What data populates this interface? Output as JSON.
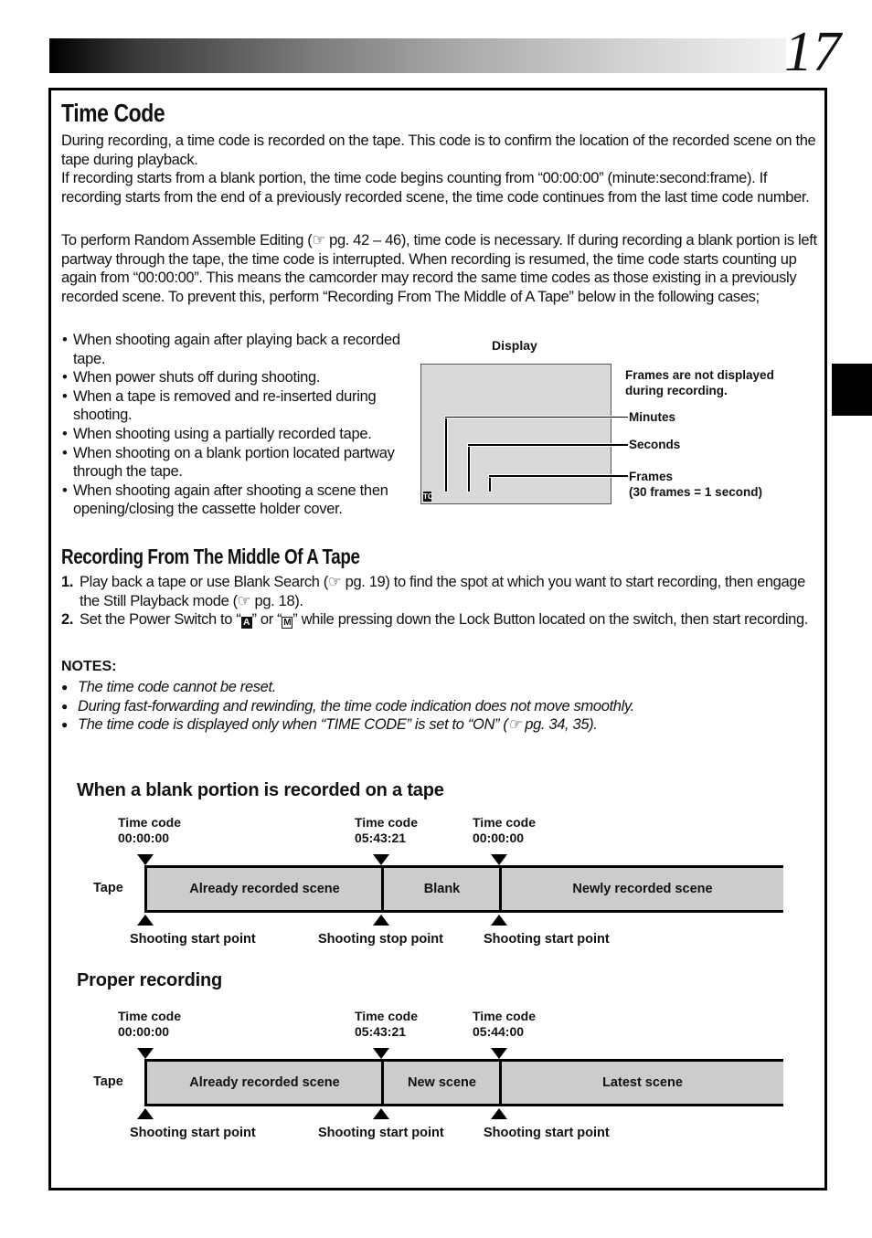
{
  "header": {
    "page_number": "17"
  },
  "section_time_code": {
    "title": "Time Code",
    "para1": "During recording, a time code is recorded on the tape. This code is to confirm the location of the recorded scene on the tape during playback.\nIf recording starts from a blank portion, the time code begins counting from “00:00:00” (minute:second:frame). If recording starts from the end of a previously recorded scene, the time code continues from the last time code number.",
    "para2": "To perform Random Assemble Editing (☞ pg. 42 – 46), time code is necessary. If during recording a blank portion is left partway through the tape, the time code is interrupted. When recording is resumed, the time code starts counting up again from “00:00:00”. This means the camcorder may record the same time codes as those existing in a previously recorded scene. To prevent this, perform “Recording From The Middle of A Tape” below in the following cases;",
    "cases": [
      "When shooting again after playing back a recorded tape.",
      "When power shuts off during shooting.",
      "When a tape is removed and re-inserted during shooting.",
      "When shooting using a partially recorded tape.",
      "When shooting on a blank portion located partway through the tape.",
      "When shooting again after shooting a scene then opening/closing the cassette holder cover."
    ]
  },
  "display_diagram": {
    "label": "Display",
    "icon": "TC",
    "note": "Frames are not displayed during recording.",
    "minutes": "Minutes",
    "seconds": "Seconds",
    "frames": "Frames",
    "frames_note": "(30 frames = 1 second)"
  },
  "section_middle": {
    "title": "Recording From The Middle Of A Tape",
    "step1_num": "1.",
    "step1": "Play back a tape or use Blank Search (☞ pg. 19) to find the spot at which you want to start recording, then engage the Still Playback mode (☞ pg. 18).",
    "step2_num": "2.",
    "step2_a": "Set the Power Switch to “",
    "step2_glyph_a": "A",
    "step2_b": "” or “",
    "step2_glyph_m": "M",
    "step2_c": "” while pressing down the Lock Button located on the switch, then start recording."
  },
  "notes": {
    "heading": "NOTES:",
    "items": [
      "The time code cannot be reset.",
      "During fast-forwarding and rewinding, the time code indication does not move smoothly.",
      "The time code is displayed only when “TIME CODE” is set to “ON” (☞ pg. 34, 35)."
    ]
  },
  "diagram_blank": {
    "heading": "When a blank portion is recorded on a tape",
    "tape_label": "Tape",
    "timecodes": [
      {
        "label": "Time code",
        "value": "00:00:00"
      },
      {
        "label": "Time code",
        "value": "05:43:21"
      },
      {
        "label": "Time code",
        "value": "00:00:00"
      }
    ],
    "segments": [
      "Already recorded scene",
      "Blank",
      "Newly recorded scene"
    ],
    "points": [
      "Shooting start point",
      "Shooting stop point",
      "Shooting start point"
    ]
  },
  "diagram_proper": {
    "heading": "Proper recording",
    "tape_label": "Tape",
    "timecodes": [
      {
        "label": "Time code",
        "value": "00:00:00"
      },
      {
        "label": "Time code",
        "value": "05:43:21"
      },
      {
        "label": "Time code",
        "value": "05:44:00"
      }
    ],
    "segments": [
      "Already recorded scene",
      "New scene",
      "Latest scene"
    ],
    "points": [
      "Shooting start point",
      "Shooting start point",
      "Shooting start point"
    ]
  }
}
